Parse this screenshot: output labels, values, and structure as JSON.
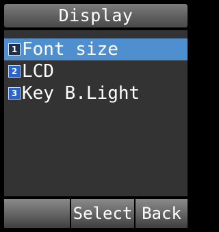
{
  "header": {
    "title": "Display"
  },
  "menu": {
    "items": [
      {
        "number": "1",
        "label": "Font size",
        "selected": true
      },
      {
        "number": "2",
        "label": "LCD",
        "selected": false
      },
      {
        "number": "3",
        "label": "Key B.Light",
        "selected": false
      }
    ]
  },
  "softkeys": {
    "left": "",
    "center": "Select",
    "right": "Back"
  },
  "colors": {
    "selection": "#4f8fd0",
    "number_icon": "#2a64d0",
    "background": "#333333"
  }
}
